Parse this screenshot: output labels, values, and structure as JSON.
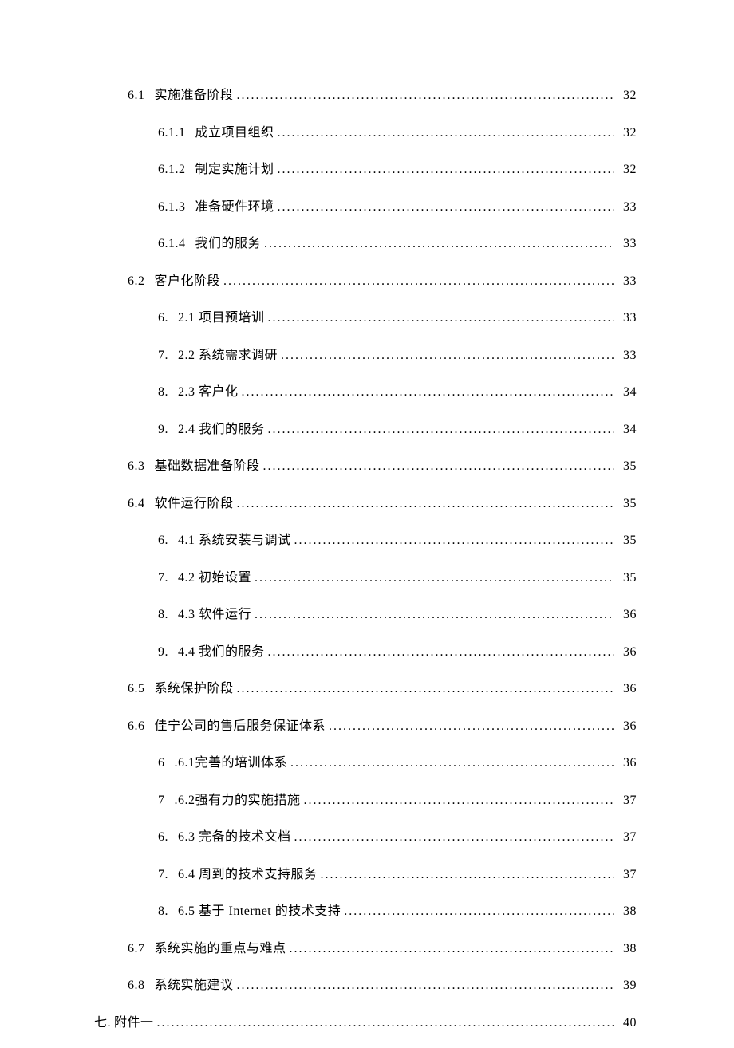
{
  "toc": [
    {
      "indent": 1,
      "num": "6.1",
      "label": "实施准备阶段",
      "page": "32"
    },
    {
      "indent": 2,
      "num": "6.1.1",
      "label": "成立项目组织",
      "page": "32"
    },
    {
      "indent": 2,
      "num": "6.1.2",
      "label": "制定实施计划",
      "page": "32"
    },
    {
      "indent": 2,
      "num": "6.1.3",
      "label": "准备硬件环境",
      "page": "33"
    },
    {
      "indent": 2,
      "num": "6.1.4",
      "label": "我们的服务",
      "page": "33"
    },
    {
      "indent": 1,
      "num": "6.2",
      "label": "客户化阶段",
      "page": "33"
    },
    {
      "indent": 2,
      "num": "6.",
      "label": "2.1 项目预培训",
      "page": "33"
    },
    {
      "indent": 2,
      "num": "7.",
      "label": "2.2 系统需求调研",
      "page": "33"
    },
    {
      "indent": 2,
      "num": "8.",
      "label": "2.3 客户化",
      "page": "34"
    },
    {
      "indent": 2,
      "num": "9.",
      "label": "2.4 我们的服务",
      "page": "34"
    },
    {
      "indent": 1,
      "num": "6.3",
      "label": "基础数据准备阶段",
      "page": "35"
    },
    {
      "indent": 1,
      "num": "6.4",
      "label": "软件运行阶段",
      "page": "35"
    },
    {
      "indent": 2,
      "num": "6.",
      "label": "4.1 系统安装与调试",
      "page": "35"
    },
    {
      "indent": 2,
      "num": "7.",
      "label": "4.2 初始设置",
      "page": "35"
    },
    {
      "indent": 2,
      "num": "8.",
      "label": "4.3 软件运行",
      "page": "36"
    },
    {
      "indent": 2,
      "num": "9.",
      "label": "4.4 我们的服务",
      "page": "36"
    },
    {
      "indent": 1,
      "num": "6.5",
      "label": "系统保护阶段",
      "page": "36"
    },
    {
      "indent": 1,
      "num": "6.6",
      "label": "佳宁公司的售后服务保证体系",
      "page": "36"
    },
    {
      "indent": 2,
      "num": "6",
      "label": ".6.1完善的培训体系",
      "page": "36"
    },
    {
      "indent": 2,
      "num": "7",
      "label": ".6.2强有力的实施措施",
      "page": "37"
    },
    {
      "indent": 2,
      "num": "6.",
      "label": "6.3 完备的技术文档",
      "page": "37"
    },
    {
      "indent": 2,
      "num": "7.",
      "label": "6.4 周到的技术支持服务",
      "page": "37"
    },
    {
      "indent": 2,
      "num": "8.",
      "label": "6.5 基于 Internet 的技术支持",
      "page": "38"
    },
    {
      "indent": 1,
      "num": "6.7",
      "label": "系统实施的重点与难点",
      "page": "38"
    },
    {
      "indent": 1,
      "num": "6.8",
      "label": "系统实施建议",
      "page": "39"
    },
    {
      "indent": 0,
      "num": "七.",
      "label": "附件一",
      "page": "40"
    }
  ]
}
